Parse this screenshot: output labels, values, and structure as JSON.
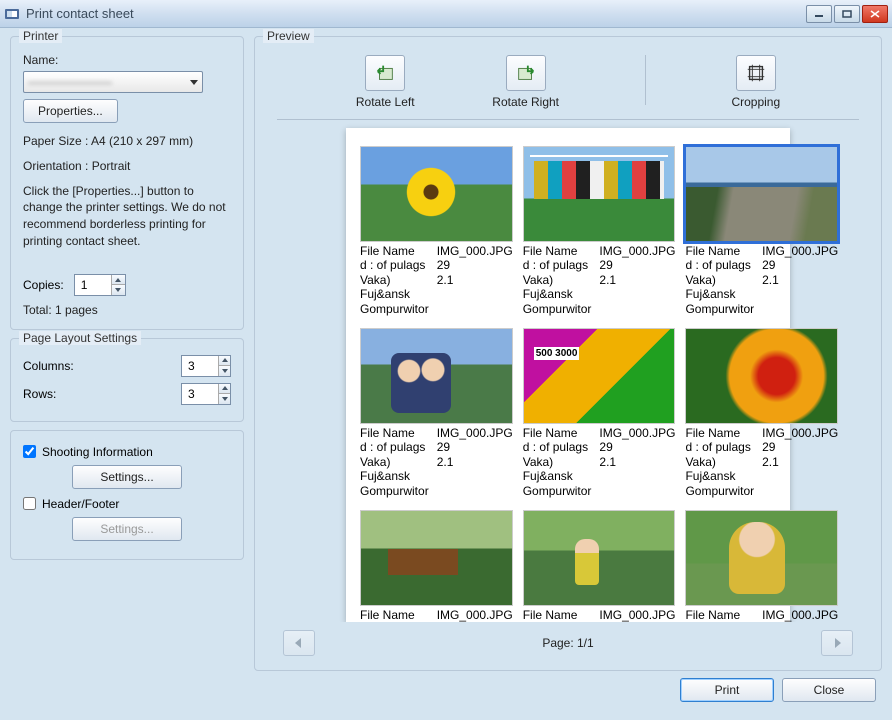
{
  "window": {
    "title": "Print contact sheet"
  },
  "printer": {
    "legend": "Printer",
    "name_label": "Name:",
    "name_value": "———————",
    "properties_btn": "Properties...",
    "paper_size": "Paper Size : A4 (210 x 297 mm)",
    "orientation": "Orientation : Portrait",
    "help_text": "Click the [Properties...] button to change the printer settings. We do not recommend borderless printing for printing contact sheet.",
    "copies_label": "Copies:",
    "copies_value": "1",
    "total_pages": "Total: 1 pages"
  },
  "page_layout": {
    "legend": "Page Layout Settings",
    "columns_label": "Columns:",
    "columns_value": "3",
    "rows_label": "Rows:",
    "rows_value": "3"
  },
  "shooting_info": {
    "checkbox_label": "Shooting Information",
    "checked": true,
    "settings_btn": "Settings..."
  },
  "header_footer": {
    "checkbox_label": "Header/Footer",
    "checked": false,
    "settings_btn": "Settings..."
  },
  "preview": {
    "legend": "Preview",
    "rotate_left": "Rotate Left",
    "rotate_right": "Rotate Right",
    "cropping": "Cropping",
    "page_label": "Page: 1/1",
    "selected_index": 2,
    "thumb_info": {
      "line1": "File Name",
      "line2": "d : of pulags Vaka)",
      "line3": "Fuj&ansk Gompurwitor",
      "col2_line1": "IMG_000.JPG",
      "col2_line2": "29",
      "col2_line3": "2.1"
    }
  },
  "footer": {
    "print": "Print",
    "close": "Close"
  }
}
